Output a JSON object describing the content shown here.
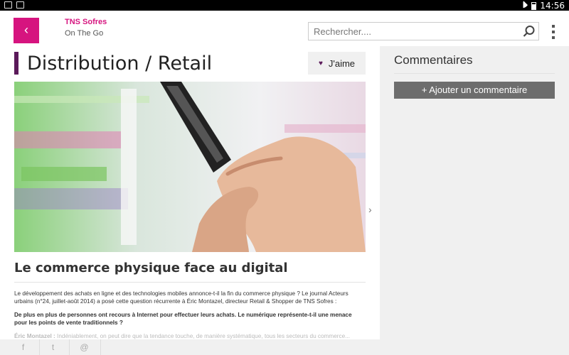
{
  "statusbar": {
    "time": "14:56"
  },
  "header": {
    "back_icon": "chevron-left-icon",
    "brand": "TNS Sofres",
    "tagline": "On The Go",
    "search_placeholder": "Rechercher....",
    "search_icon": "search-icon",
    "menu_icon": "kebab-menu-icon"
  },
  "article": {
    "title": "Distribution / Retail",
    "like_label": "J'aime",
    "headline": "Le commerce physique face au digital",
    "paragraph_1": "Le développement des achats en ligne et des technologies mobiles annonce-t-il la fin du commerce physique ? Le journal Acteurs urbains (n°24, juillet-août 2014) a posé cette question récurrente à Éric Montazel, directeur Retail & Shopper de TNS Sofres :",
    "paragraph_2": "De plus en plus de personnes ont recours à Internet pour effectuer leurs achats. Le numérique représente-t-il une menace pour les points de vente traditionnels ?",
    "paragraph_3_speaker": "Éric Montazel :",
    "paragraph_3": " Indéniablement, on peut dire que la tendance touche, de manière systématique, tous les secteurs du commerce..."
  },
  "comments": {
    "title": "Commentaires",
    "add_label": "+ Ajouter un commentaire"
  },
  "share": {
    "facebook": "f",
    "twitter": "t",
    "email": "@"
  },
  "colors": {
    "accent": "#d6147f",
    "title_bar": "#5b1a5a",
    "button_gray": "#6d6d6d"
  }
}
